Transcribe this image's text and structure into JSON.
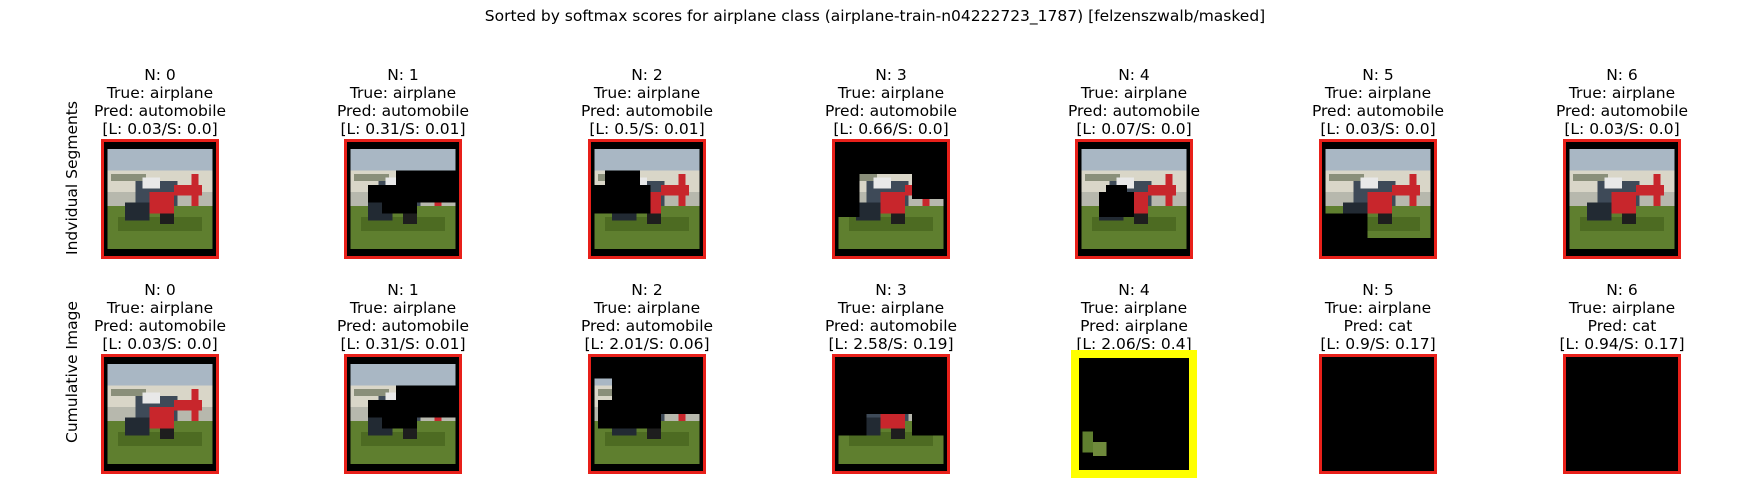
{
  "figure": {
    "title": "Sorted by softmax scores for airplane class (airplane-train-n04222723_1787) [felzenszwalb/masked]",
    "rows": [
      {
        "label": "Indvidual Segments",
        "panels": [
          {
            "n": "N: 0",
            "true": "True: airplane",
            "pred": "Pred: automobile",
            "scores": "[L: 0.03/S: 0.0]",
            "highlight": false,
            "mask": "none"
          },
          {
            "n": "N: 1",
            "true": "True: airplane",
            "pred": "Pred: automobile",
            "scores": "[L: 0.31/S: 0.01]",
            "highlight": false,
            "mask": "right-hull"
          },
          {
            "n": "N: 2",
            "true": "True: airplane",
            "pred": "Pred: automobile",
            "scores": "[L: 0.5/S: 0.01]",
            "highlight": false,
            "mask": "left-hull"
          },
          {
            "n": "N: 3",
            "true": "True: airplane",
            "pred": "Pred: automobile",
            "scores": "[L: 0.66/S: 0.0]",
            "highlight": false,
            "mask": "top-band"
          },
          {
            "n": "N: 4",
            "true": "True: airplane",
            "pred": "Pred: automobile",
            "scores": "[L: 0.07/S: 0.0]",
            "highlight": false,
            "mask": "center-blob"
          },
          {
            "n": "N: 5",
            "true": "True: airplane",
            "pred": "Pred: automobile",
            "scores": "[L: 0.03/S: 0.0]",
            "highlight": false,
            "mask": "bottom-left"
          },
          {
            "n": "N: 6",
            "true": "True: airplane",
            "pred": "Pred: automobile",
            "scores": "[L: 0.03/S: 0.0]",
            "highlight": false,
            "mask": "none"
          }
        ]
      },
      {
        "label": "Cumulative Image",
        "panels": [
          {
            "n": "N: 0",
            "true": "True: airplane",
            "pred": "Pred: automobile",
            "scores": "[L: 0.03/S: 0.0]",
            "highlight": false,
            "mask": "none"
          },
          {
            "n": "N: 1",
            "true": "True: airplane",
            "pred": "Pred: automobile",
            "scores": "[L: 0.31/S: 0.01]",
            "highlight": false,
            "mask": "right-hull"
          },
          {
            "n": "N: 2",
            "true": "True: airplane",
            "pred": "Pred: automobile",
            "scores": "[L: 2.01/S: 0.06]",
            "highlight": false,
            "mask": "cum2"
          },
          {
            "n": "N: 3",
            "true": "True: airplane",
            "pred": "Pred: automobile",
            "scores": "[L: 2.58/S: 0.19]",
            "highlight": false,
            "mask": "cum3"
          },
          {
            "n": "N: 4",
            "true": "True: airplane",
            "pred": "Pred: airplane",
            "scores": "[L: 2.06/S: 0.4]",
            "highlight": true,
            "mask": "cum4"
          },
          {
            "n": "N: 5",
            "true": "True: airplane",
            "pred": "Pred: cat",
            "scores": "[L: 0.9/S: 0.17]",
            "highlight": false,
            "mask": "all"
          },
          {
            "n": "N: 6",
            "true": "True: airplane",
            "pred": "Pred: cat",
            "scores": "[L: 0.94/S: 0.17]",
            "highlight": false,
            "mask": "all"
          }
        ]
      }
    ]
  },
  "colors": {
    "frame": "#e8201a",
    "highlight": "#ffff00",
    "mask": "#000000",
    "sky": "#a9b7c4",
    "hangar": "#d9d6c8",
    "grass": "#5f7f2f",
    "plane_body": "#3e4a58",
    "plane_red": "#c8262c",
    "plane_white": "#e8e8e8"
  }
}
